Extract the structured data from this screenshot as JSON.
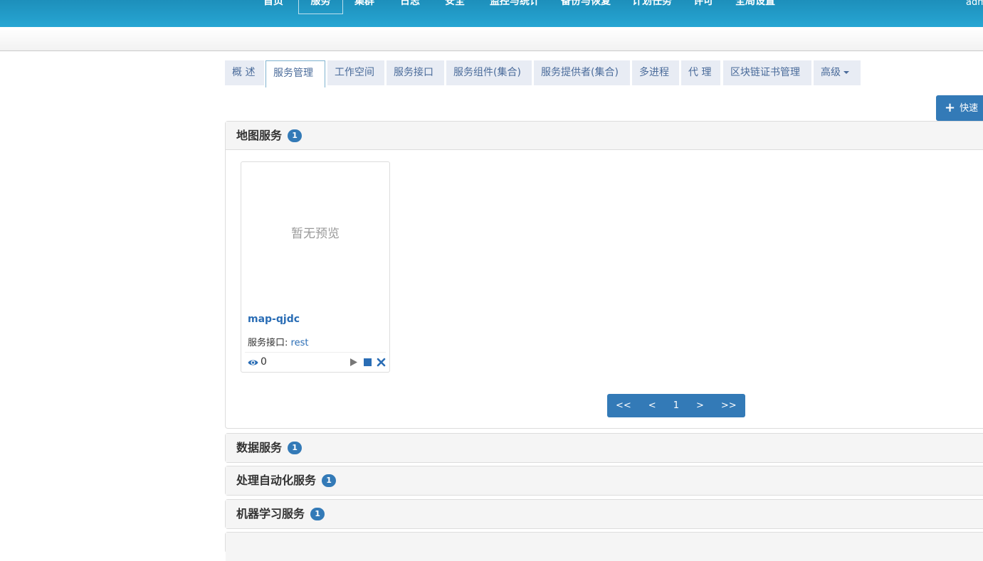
{
  "topnav": {
    "items": [
      {
        "label": "首页"
      },
      {
        "label": "服务",
        "active": true
      },
      {
        "label": "集群"
      },
      {
        "label": "日志"
      },
      {
        "label": "安全"
      },
      {
        "label": "监控与统计"
      },
      {
        "label": "备份与恢复"
      },
      {
        "label": "计划任务"
      },
      {
        "label": "许可"
      },
      {
        "label": "全局设置"
      }
    ],
    "user": "adm"
  },
  "tabs": [
    {
      "label": "概 述"
    },
    {
      "label": "服务管理",
      "active": true
    },
    {
      "label": "工作空间"
    },
    {
      "label": "服务接口"
    },
    {
      "label": "服务组件(集合)"
    },
    {
      "label": "服务提供者(集合)"
    },
    {
      "label": "多进程"
    },
    {
      "label": "代 理"
    },
    {
      "label": "区块链证书管理"
    },
    {
      "label": "高级"
    }
  ],
  "quick_button": {
    "label": "快速"
  },
  "sections": [
    {
      "title": "地图服务",
      "count": "1",
      "expanded": true
    },
    {
      "title": "数据服务",
      "count": "1"
    },
    {
      "title": "处理自动化服务",
      "count": "1"
    },
    {
      "title": "机器学习服务",
      "count": "1"
    }
  ],
  "card": {
    "preview_text": "暂无预览",
    "name": "map-qjdc",
    "interface_label": "服务接口:",
    "interface_value": "rest",
    "views": "0"
  },
  "pager": [
    "<<",
    "<",
    "1",
    ">",
    ">>"
  ],
  "colors": {
    "nav": "#27a6d3",
    "primary": "#337ab7",
    "tab_bg": "#e8ecf4"
  }
}
